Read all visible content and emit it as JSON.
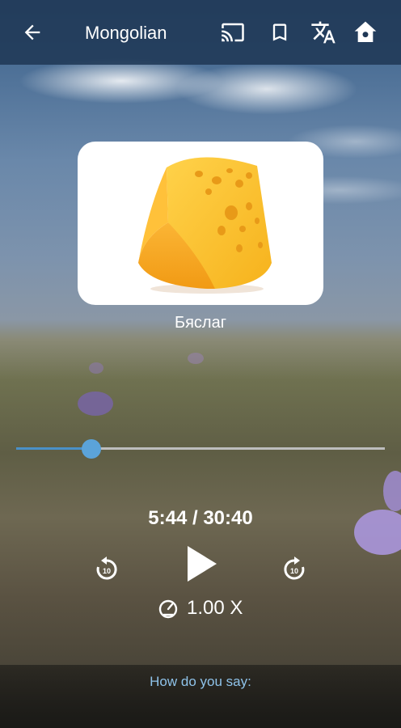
{
  "topbar": {
    "title": "Mongolian",
    "back_icon": "arrow-left-icon",
    "cast_icon": "cast-icon",
    "bookmark_icon": "bookmark-icon",
    "translate_icon": "translate-icon",
    "home_icon": "home-icon"
  },
  "card": {
    "image": "cheese-image",
    "word": "Бяслаг"
  },
  "player": {
    "progress": 0.205,
    "time": "5:44 / 30:40",
    "rewind_label": "10",
    "forward_label": "10",
    "speed": "1.00 X"
  },
  "footer": {
    "prompt": "How do you say:"
  },
  "colors": {
    "topbar": "#1e3755",
    "accent": "#5ba3d9",
    "hint_text": "#8fc3ea"
  }
}
